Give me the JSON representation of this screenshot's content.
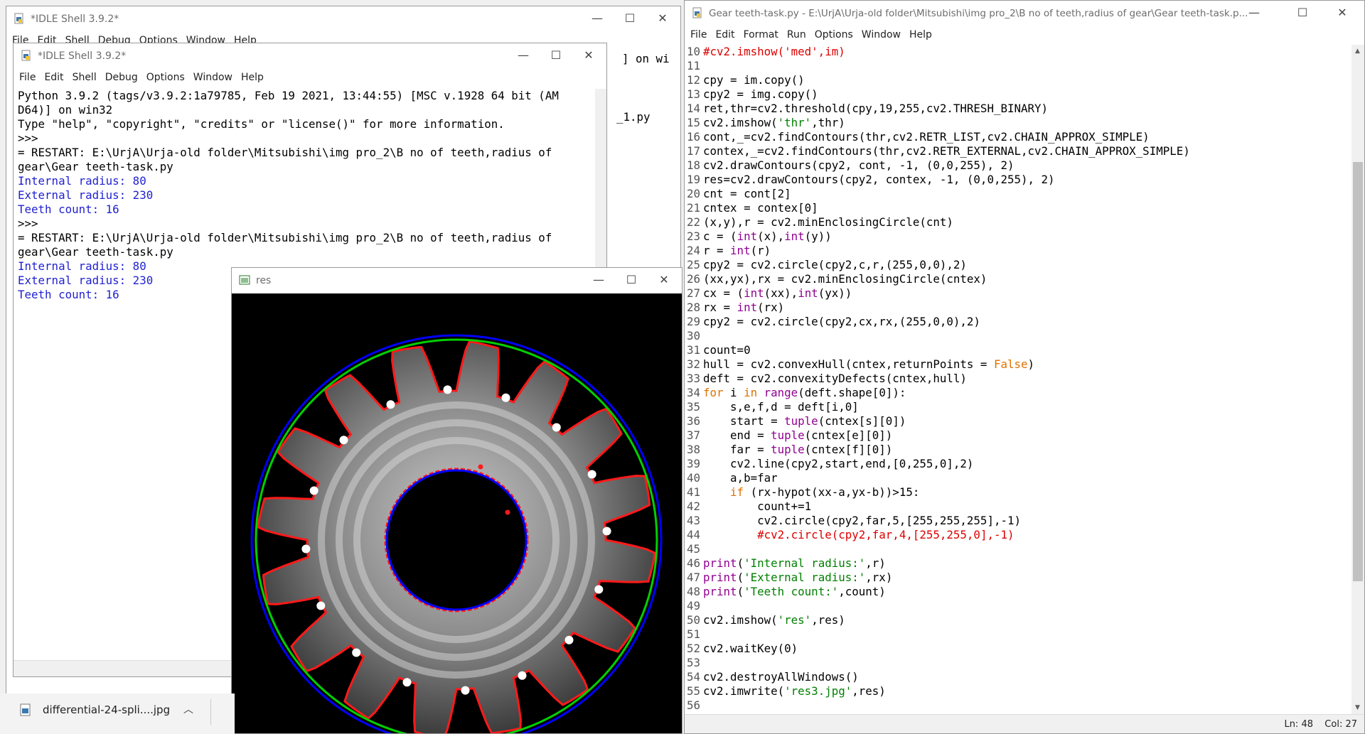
{
  "shell_back": {
    "title": "*IDLE Shell 3.9.2*",
    "menu": [
      "File",
      "Edit",
      "Shell",
      "Debug",
      "Options",
      "Window",
      "Help"
    ],
    "partial_right": [
      "] on wi",
      "_1.py"
    ]
  },
  "shell_front": {
    "title": "*IDLE Shell 3.9.2*",
    "menu": [
      "File",
      "Edit",
      "Shell",
      "Debug",
      "Options",
      "Window",
      "Help"
    ],
    "lines": [
      {
        "t": "Python 3.9.2 (tags/v3.9.2:1a79785, Feb 19 2021, 13:44:55) [MSC v.1928 64 bit (AM",
        "c": ""
      },
      {
        "t": "D64)] on win32",
        "c": ""
      },
      {
        "t": "Type \"help\", \"copyright\", \"credits\" or \"license()\" for more information.",
        "c": ""
      },
      {
        "t": ">>>",
        "c": ""
      },
      {
        "t": "= RESTART: E:\\UrjA\\Urja-old folder\\Mitsubishi\\img pro_2\\B no of teeth,radius of",
        "c": ""
      },
      {
        "t": "gear\\Gear teeth-task.py",
        "c": ""
      },
      {
        "t": "Internal radius: 80",
        "c": "blue"
      },
      {
        "t": "External radius: 230",
        "c": "blue"
      },
      {
        "t": "Teeth count: 16",
        "c": "blue"
      },
      {
        "t": ">>>",
        "c": ""
      },
      {
        "t": "= RESTART: E:\\UrjA\\Urja-old folder\\Mitsubishi\\img pro_2\\B no of teeth,radius of",
        "c": ""
      },
      {
        "t": "gear\\Gear teeth-task.py",
        "c": ""
      },
      {
        "t": "Internal radius: 80",
        "c": "blue"
      },
      {
        "t": "External radius: 230",
        "c": "blue"
      },
      {
        "t": "Teeth count: 16",
        "c": "blue"
      }
    ]
  },
  "res_window": {
    "title": "res"
  },
  "editor": {
    "title": "Gear teeth-task.py - E:\\UrjA\\Urja-old folder\\Mitsubishi\\img pro_2\\B no of teeth,radius of gear\\Gear teeth-task.p...",
    "menu": [
      "File",
      "Edit",
      "Format",
      "Run",
      "Options",
      "Window",
      "Help"
    ],
    "status_ln": "Ln: 48",
    "status_col": "Col: 27",
    "lines": [
      {
        "n": "10",
        "s": [
          [
            "#cv2.imshow('med',im)",
            "cmt"
          ]
        ]
      },
      {
        "n": "11",
        "s": []
      },
      {
        "n": "12",
        "s": [
          [
            "cpy = im.copy()",
            ""
          ]
        ]
      },
      {
        "n": "13",
        "s": [
          [
            "cpy2 = img.copy()",
            ""
          ]
        ]
      },
      {
        "n": "14",
        "s": [
          [
            "ret,thr=cv2.threshold(cpy,19,255,cv2.THRESH_BINARY)",
            ""
          ]
        ]
      },
      {
        "n": "15",
        "s": [
          [
            "cv2.imshow(",
            ""
          ],
          [
            "'thr'",
            "str"
          ],
          [
            ",thr)",
            ""
          ]
        ]
      },
      {
        "n": "16",
        "s": [
          [
            "cont,_=cv2.findContours(thr,cv2.RETR_LIST,cv2.CHAIN_APPROX_SIMPLE)",
            ""
          ]
        ]
      },
      {
        "n": "17",
        "s": [
          [
            "contex,_=cv2.findContours(thr,cv2.RETR_EXTERNAL,cv2.CHAIN_APPROX_SIMPLE)",
            ""
          ]
        ]
      },
      {
        "n": "18",
        "s": [
          [
            "cv2.drawContours(cpy2, cont, -1, (0,0,255), 2)",
            ""
          ]
        ]
      },
      {
        "n": "19",
        "s": [
          [
            "res=cv2.drawContours(cpy2, contex, -1, (0,0,255), 2)",
            ""
          ]
        ]
      },
      {
        "n": "20",
        "s": [
          [
            "cnt = cont[2]",
            ""
          ]
        ]
      },
      {
        "n": "21",
        "s": [
          [
            "cntex = contex[0]",
            ""
          ]
        ]
      },
      {
        "n": "22",
        "s": [
          [
            "(x,y),r = cv2.minEnclosingCircle(cnt)",
            ""
          ]
        ]
      },
      {
        "n": "23",
        "s": [
          [
            "c = (",
            ""
          ],
          [
            "int",
            "bi"
          ],
          [
            "(x),",
            ""
          ],
          [
            "int",
            "bi"
          ],
          [
            "(y))",
            ""
          ]
        ]
      },
      {
        "n": "24",
        "s": [
          [
            "r = ",
            ""
          ],
          [
            "int",
            "bi"
          ],
          [
            "(r)",
            ""
          ]
        ]
      },
      {
        "n": "25",
        "s": [
          [
            "cpy2 = cv2.circle(cpy2,c,r,(255,0,0),2)",
            ""
          ]
        ]
      },
      {
        "n": "26",
        "s": [
          [
            "(xx,yx),rx = cv2.minEnclosingCircle(cntex)",
            ""
          ]
        ]
      },
      {
        "n": "27",
        "s": [
          [
            "cx = (",
            ""
          ],
          [
            "int",
            "bi"
          ],
          [
            "(xx),",
            ""
          ],
          [
            "int",
            "bi"
          ],
          [
            "(yx))",
            ""
          ]
        ]
      },
      {
        "n": "28",
        "s": [
          [
            "rx = ",
            ""
          ],
          [
            "int",
            "bi"
          ],
          [
            "(rx)",
            ""
          ]
        ]
      },
      {
        "n": "29",
        "s": [
          [
            "cpy2 = cv2.circle(cpy2,cx,rx,(255,0,0),2)",
            ""
          ]
        ]
      },
      {
        "n": "30",
        "s": []
      },
      {
        "n": "31",
        "s": [
          [
            "count=0",
            ""
          ]
        ]
      },
      {
        "n": "32",
        "s": [
          [
            "hull = cv2.convexHull(cntex,returnPoints = ",
            ""
          ],
          [
            "False",
            "kw"
          ],
          [
            ")",
            ""
          ]
        ]
      },
      {
        "n": "33",
        "s": [
          [
            "deft = cv2.convexityDefects(cntex,hull)",
            ""
          ]
        ]
      },
      {
        "n": "34",
        "s": [
          [
            "for",
            "kw"
          ],
          [
            " i ",
            ""
          ],
          [
            "in",
            "kw"
          ],
          [
            " ",
            ""
          ],
          [
            "range",
            "bi"
          ],
          [
            "(deft.shape[0]):",
            ""
          ]
        ]
      },
      {
        "n": "35",
        "s": [
          [
            "    s,e,f,d = deft[i,0]",
            ""
          ]
        ]
      },
      {
        "n": "36",
        "s": [
          [
            "    start = ",
            ""
          ],
          [
            "tuple",
            "bi"
          ],
          [
            "(cntex[s][0])",
            ""
          ]
        ]
      },
      {
        "n": "37",
        "s": [
          [
            "    end = ",
            ""
          ],
          [
            "tuple",
            "bi"
          ],
          [
            "(cntex[e][0])",
            ""
          ]
        ]
      },
      {
        "n": "38",
        "s": [
          [
            "    far = ",
            ""
          ],
          [
            "tuple",
            "bi"
          ],
          [
            "(cntex[f][0])",
            ""
          ]
        ]
      },
      {
        "n": "39",
        "s": [
          [
            "    cv2.line(cpy2,start,end,[0,255,0],2)",
            ""
          ]
        ]
      },
      {
        "n": "40",
        "s": [
          [
            "    a,b=far",
            ""
          ]
        ]
      },
      {
        "n": "41",
        "s": [
          [
            "    ",
            ""
          ],
          [
            "if",
            "kw"
          ],
          [
            " (rx-hypot(xx-a,yx-b))>15:",
            ""
          ]
        ]
      },
      {
        "n": "42",
        "s": [
          [
            "        count+=1",
            ""
          ]
        ]
      },
      {
        "n": "43",
        "s": [
          [
            "        cv2.circle(cpy2,far,5,[255,255,255],-1)",
            ""
          ]
        ]
      },
      {
        "n": "44",
        "s": [
          [
            "        ",
            ""
          ],
          [
            "#cv2.circle(cpy2,far,4,[255,255,0],-1)",
            "cmt"
          ]
        ]
      },
      {
        "n": "45",
        "s": []
      },
      {
        "n": "46",
        "s": [
          [
            "print",
            "bi"
          ],
          [
            "(",
            ""
          ],
          [
            "'Internal radius:'",
            "str"
          ],
          [
            ",r)",
            ""
          ]
        ]
      },
      {
        "n": "47",
        "s": [
          [
            "print",
            "bi"
          ],
          [
            "(",
            ""
          ],
          [
            "'External radius:'",
            "str"
          ],
          [
            ",rx)",
            ""
          ]
        ]
      },
      {
        "n": "48",
        "s": [
          [
            "print",
            "bi"
          ],
          [
            "(",
            ""
          ],
          [
            "'Teeth count:'",
            "str"
          ],
          [
            ",count)",
            ""
          ]
        ]
      },
      {
        "n": "49",
        "s": []
      },
      {
        "n": "50",
        "s": [
          [
            "cv2.imshow(",
            ""
          ],
          [
            "'res'",
            "str"
          ],
          [
            ",res)",
            ""
          ]
        ]
      },
      {
        "n": "51",
        "s": []
      },
      {
        "n": "52",
        "s": [
          [
            "cv2.waitKey(0)",
            ""
          ]
        ]
      },
      {
        "n": "53",
        "s": []
      },
      {
        "n": "54",
        "s": [
          [
            "cv2.destroyAllWindows()",
            ""
          ]
        ]
      },
      {
        "n": "55",
        "s": [
          [
            "cv2.imwrite(",
            ""
          ],
          [
            "'res3.jpg'",
            "str"
          ],
          [
            ",res)",
            ""
          ]
        ]
      },
      {
        "n": "56",
        "s": []
      }
    ]
  },
  "taskbar": {
    "file_label": "differential-24-spli....jpg"
  },
  "colors": {
    "shell_output": "#1f1fd1",
    "keyword": "#e07000",
    "builtin": "#900090",
    "string": "#008000",
    "comment": "#dd0000"
  }
}
